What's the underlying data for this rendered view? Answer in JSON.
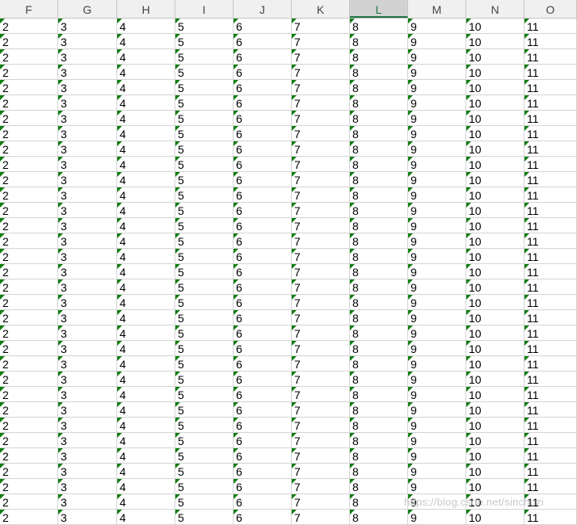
{
  "columns": [
    "F",
    "G",
    "H",
    "I",
    "J",
    "K",
    "L",
    "M",
    "N",
    "O"
  ],
  "selected_column": "L",
  "cell_values": [
    "2",
    "3",
    "4",
    "5",
    "6",
    "7",
    "8",
    "9",
    "10",
    "11"
  ],
  "row_count": 33,
  "watermark": "https://blog.csdn.net/sinchuzi",
  "colors": {
    "header_bg": "#f0f0f0",
    "selected_header_bg": "#d2d2d2",
    "accent": "#217346",
    "error_flag": "#107c10",
    "gridline": "#d4d4d4"
  }
}
